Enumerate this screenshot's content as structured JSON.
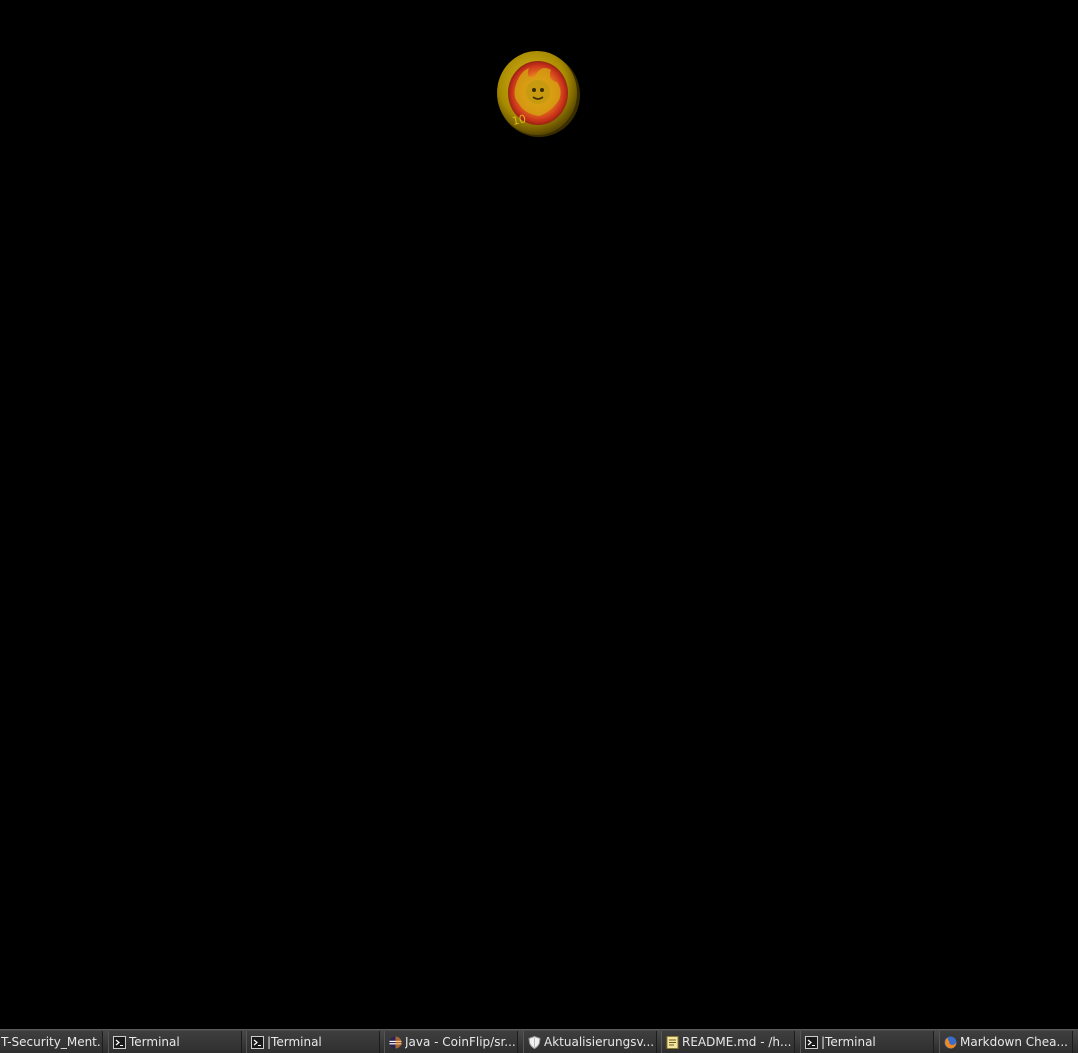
{
  "colors": {
    "desktop_background": "#000000",
    "taskbar_background": "#3a3a3a",
    "taskbar_text": "#e8e8e8",
    "coin_gold": "#c9a400",
    "coin_fire": "#e2501a"
  },
  "coin": {
    "denomination": "10",
    "icon": "flaming-coin-icon"
  },
  "taskbar": {
    "items": [
      {
        "label": "T-Security_Ment...",
        "icon": "none"
      },
      {
        "label": "Terminal",
        "icon": "terminal-icon"
      },
      {
        "label": "|Terminal",
        "icon": "terminal-icon"
      },
      {
        "label": "Java - CoinFlip/sr...",
        "icon": "eclipse-icon"
      },
      {
        "label": "Aktualisierungsv...",
        "icon": "shield-icon"
      },
      {
        "label": "README.md - /h...",
        "icon": "text-editor-icon"
      },
      {
        "label": "|Terminal",
        "icon": "terminal-icon"
      },
      {
        "label": "Markdown Chea...",
        "icon": "firefox-icon"
      }
    ]
  }
}
